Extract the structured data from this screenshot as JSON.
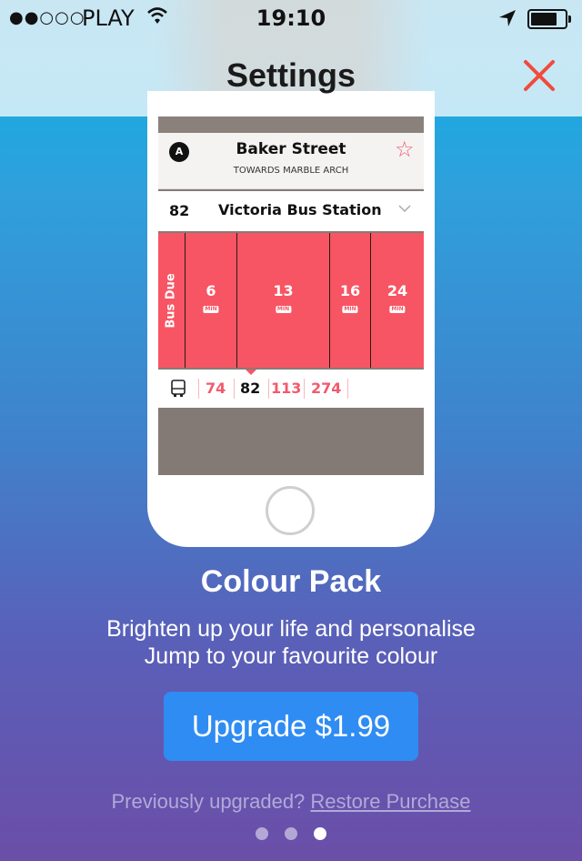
{
  "status_bar": {
    "signal": "●●○○○",
    "carrier": "PLAY",
    "time": "19:10"
  },
  "header": {
    "title": "Settings",
    "close_icon": "close-icon"
  },
  "preview": {
    "stop": {
      "line_badge": "A",
      "name": "Baker Street",
      "direction": "TOWARDS MARBLE ARCH"
    },
    "route": {
      "number": "82",
      "destination": "Victoria Bus Station"
    },
    "arrivals": {
      "due_label": "Bus Due",
      "unit": "MIN",
      "times": [
        "6",
        "13",
        "16",
        "24"
      ]
    },
    "bus_tabs": [
      "74",
      "82",
      "113",
      "274"
    ],
    "active_tab": "82",
    "accent_color": "#f75563"
  },
  "promo": {
    "title": "Colour Pack",
    "line1": "Brighten up your life and personalise",
    "line2": "Jump to your favourite colour",
    "upgrade_label": "Upgrade $1.99",
    "restore_prefix": "Previously upgraded?",
    "restore_link": "Restore Purchase"
  },
  "pager": {
    "pages": 3,
    "active_index": 2
  },
  "colors": {
    "button_blue": "#2f8cf3",
    "close_red": "#f24a3b"
  }
}
